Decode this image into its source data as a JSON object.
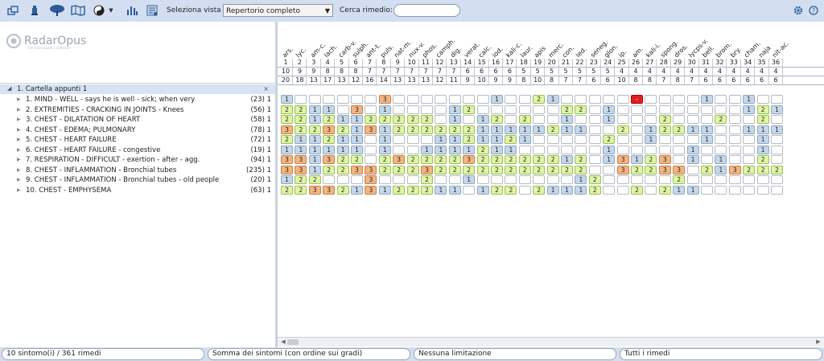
{
  "toolbar": {
    "view_label": "Seleziona vista",
    "view_value": "Repertorio completo",
    "search_label": "Cerca rimedio:",
    "search_value": "",
    "icons": [
      "windows-icon",
      "remedy-flask-icon",
      "tree-icon",
      "map-icon",
      "yin-yang-icon",
      "chevron-down-icon",
      "analysis-icon",
      "list-settings-icon",
      "gear-icon",
      "help-icon"
    ]
  },
  "logo": {
    "name": "RadarOpus",
    "tagline": "The homeopathic software"
  },
  "clipboard": {
    "folder": "1. Cartella appunti 1",
    "close": "×"
  },
  "symptoms": [
    {
      "name": "1. MIND - WELL - says he is well - sick; when very",
      "count": "(23) 1"
    },
    {
      "name": "2. EXTREMITIES - CRACKING IN JOINTS - Knees",
      "count": "(56) 1"
    },
    {
      "name": "3. CHEST - DILATATION OF HEART",
      "count": "(58) 1"
    },
    {
      "name": "4. CHEST - EDEMA; PULMONARY",
      "count": "(78) 1"
    },
    {
      "name": "5. CHEST - HEART FAILURE",
      "count": "(72) 1"
    },
    {
      "name": "6. CHEST - HEART FAILURE - congestive",
      "count": "(19) 1"
    },
    {
      "name": "7. RESPIRATION - DIFFICULT - exertion - after - agg.",
      "count": "(94) 1"
    },
    {
      "name": "8. CHEST - INFLAMMATION - Bronchial tubes",
      "count": "(235) 1"
    },
    {
      "name": "9. CHEST - INFLAMMATION - Bronchial tubes - old people",
      "count": "(20) 1"
    },
    {
      "name": "10. CHEST - EMPHYSEMA",
      "count": "(63) 1"
    }
  ],
  "remedies": {
    "names": [
      "ars.",
      "lyc.",
      "am-c.",
      "lach.",
      "carb-v.",
      "sulph.",
      "ant-t.",
      "puls.",
      "nat-m.",
      "nux-v.",
      "phos.",
      "camph.",
      "dig.",
      "verat.",
      "calc.",
      "iod.",
      "kali-c.",
      "laur.",
      "apis",
      "merc.",
      "con.",
      "led.",
      "seneg.",
      "glon.",
      "ip.",
      "am.",
      "kali-i.",
      "spong.",
      "dros.",
      "lycps-v.",
      "bell.",
      "brom.",
      "bry.",
      "cham.",
      "naja",
      "nit-ac."
    ],
    "rank": [
      "1",
      "2",
      "3",
      "4",
      "5",
      "6",
      "7",
      "8",
      "9",
      "10",
      "11",
      "12",
      "13",
      "14",
      "15",
      "16",
      "17",
      "18",
      "19",
      "20",
      "21",
      "22",
      "23",
      "24",
      "25",
      "26",
      "27",
      "28",
      "29",
      "30",
      "31",
      "32",
      "33",
      "34",
      "35",
      "36"
    ],
    "hits": [
      "10",
      "9",
      "9",
      "8",
      "8",
      "8",
      "7",
      "7",
      "7",
      "7",
      "7",
      "7",
      "7",
      "6",
      "6",
      "6",
      "6",
      "5",
      "5",
      "5",
      "5",
      "5",
      "5",
      "5",
      "4",
      "4",
      "4",
      "4",
      "4",
      "4",
      "4",
      "4",
      "4",
      "4",
      "4",
      "4"
    ],
    "degrees": [
      "20",
      "18",
      "13",
      "17",
      "13",
      "12",
      "16",
      "14",
      "13",
      "13",
      "13",
      "12",
      "11",
      "9",
      "10",
      "9",
      "9",
      "8",
      "10",
      "8",
      "7",
      "7",
      "6",
      "6",
      "10",
      "8",
      "8",
      "7",
      "8",
      "7",
      "6",
      "6",
      "6",
      "6",
      "6",
      "6"
    ]
  },
  "grid": [
    [
      "1",
      "",
      "",
      "",
      "",
      "",
      "",
      "3",
      "",
      "",
      "",
      "",
      "",
      "",
      "",
      "1",
      "",
      "",
      "2",
      "1",
      "",
      "",
      "",
      "",
      "",
      "r",
      "",
      "",
      "",
      "",
      "1",
      "",
      "",
      "1",
      "",
      ""
    ],
    [
      "2",
      "2",
      "1",
      "1",
      "",
      "3",
      "",
      "1",
      "",
      "",
      "",
      "",
      "1",
      "2",
      "",
      "",
      "",
      "",
      "",
      "",
      "2",
      "2",
      "",
      "1",
      "",
      "",
      "",
      "",
      "",
      "",
      "",
      "",
      "",
      "1",
      "2",
      "1"
    ],
    [
      "2",
      "2",
      "1",
      "2",
      "1",
      "1",
      "2",
      "2",
      "2",
      "2",
      "2",
      "",
      "1",
      "",
      "1",
      "2",
      "",
      "2",
      "",
      "",
      "1",
      "",
      "",
      "1",
      "",
      "",
      "",
      "2",
      "",
      "",
      "",
      "2",
      "",
      "",
      "2",
      ""
    ],
    [
      "3",
      "2",
      "2",
      "3",
      "2",
      "1",
      "3",
      "1",
      "2",
      "2",
      "2",
      "2",
      "2",
      "2",
      "1",
      "1",
      "1",
      "1",
      "1",
      "2",
      "1",
      "1",
      "",
      "",
      "2",
      "",
      "1",
      "2",
      "2",
      "1",
      "1",
      "",
      "",
      "1",
      "1",
      "1"
    ],
    [
      "2",
      "1",
      "1",
      "2",
      "1",
      "1",
      "",
      "1",
      "",
      "",
      "",
      "1",
      "1",
      "2",
      "1",
      "1",
      "2",
      "1",
      "",
      "",
      "",
      "",
      "",
      "2",
      "",
      "",
      "1",
      "",
      "",
      "",
      "1",
      "",
      "",
      "",
      "1",
      ""
    ],
    [
      "1",
      "1",
      "1",
      "1",
      "1",
      "1",
      "",
      "1",
      "",
      "",
      "1",
      "1",
      "1",
      "1",
      "2",
      "1",
      "1",
      "",
      "",
      "",
      "",
      "",
      "",
      "1",
      "",
      "",
      "",
      "",
      "",
      "1",
      "",
      "",
      "",
      "",
      "1",
      ""
    ],
    [
      "3",
      "3",
      "1",
      "3",
      "2",
      "2",
      "",
      "2",
      "3",
      "2",
      "2",
      "2",
      "2",
      "3",
      "2",
      "2",
      "2",
      "2",
      "2",
      "2",
      "1",
      "2",
      "",
      "1",
      "3",
      "1",
      "2",
      "3",
      "",
      "1",
      "",
      "1",
      "",
      "",
      "2",
      ""
    ],
    [
      "3",
      "3",
      "1",
      "2",
      "2",
      "3",
      "3",
      "2",
      "2",
      "2",
      "3",
      "2",
      "2",
      "2",
      "2",
      "2",
      "2",
      "2",
      "2",
      "2",
      "2",
      "2",
      "",
      "",
      "3",
      "2",
      "2",
      "3",
      "3",
      "",
      "2",
      "1",
      "3",
      "2",
      "2",
      "2"
    ],
    [
      "1",
      "2",
      "2",
      "",
      "",
      "",
      "3",
      "",
      "",
      "",
      "2",
      "",
      "",
      "1",
      "",
      "",
      "",
      "",
      "",
      "",
      "",
      "1",
      "2",
      "",
      "",
      "",
      "",
      "",
      "2",
      "",
      "",
      "",
      "",
      "",
      "",
      ""
    ],
    [
      "2",
      "2",
      "3",
      "3",
      "2",
      "1",
      "3",
      "1",
      "2",
      "2",
      "2",
      "1",
      "1",
      "",
      "1",
      "2",
      "2",
      "",
      "2",
      "1",
      "1",
      "1",
      "2",
      "",
      "",
      "2",
      "",
      "2",
      "1",
      "1",
      "",
      "",
      "",
      "",
      "",
      ""
    ]
  ],
  "status": {
    "counts": "10 sintomo(i) / 361 rimedi",
    "method": "Somma dei sintomi (con ordine sui gradi)",
    "limit": "Nessuna limitazione",
    "filter": "Tutti i rimedi"
  },
  "colors": {
    "grade1": "#c5d7ea",
    "grade2": "#dff5a6",
    "grade3": "#f2b581",
    "highlight": "#e02020",
    "toolbar_bg": "#d3dff0",
    "selection_bg": "#d7e3f3"
  }
}
